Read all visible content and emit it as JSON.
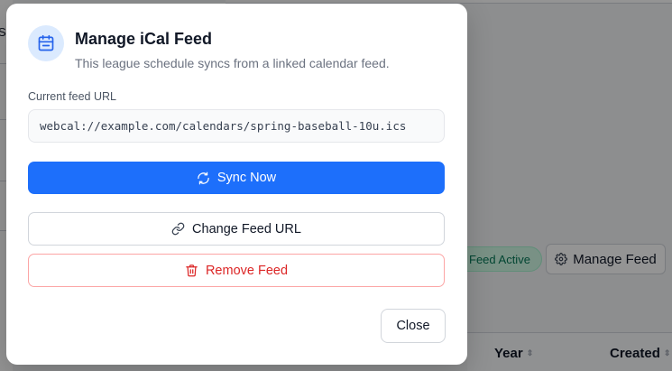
{
  "background": {
    "left_text": "Sp",
    "feed_badge": "Feed Active",
    "manage_button": "Manage Feed",
    "table_headers": [
      {
        "label": "Year"
      },
      {
        "label": "Created"
      }
    ]
  },
  "modal": {
    "icon": "calendar-icon",
    "title": "Manage iCal Feed",
    "subtitle": "This league schedule syncs from a linked calendar feed.",
    "url_label": "Current feed URL",
    "url_value": "webcal://example.com/calendars/spring-baseball-10u.ics",
    "sync_button": "Sync Now",
    "change_button": "Change Feed URL",
    "remove_button": "Remove Feed",
    "close_button": "Close"
  },
  "colors": {
    "primary": "#1d6ffb",
    "danger": "#dc2626",
    "success_badge": "#d1fae5"
  }
}
